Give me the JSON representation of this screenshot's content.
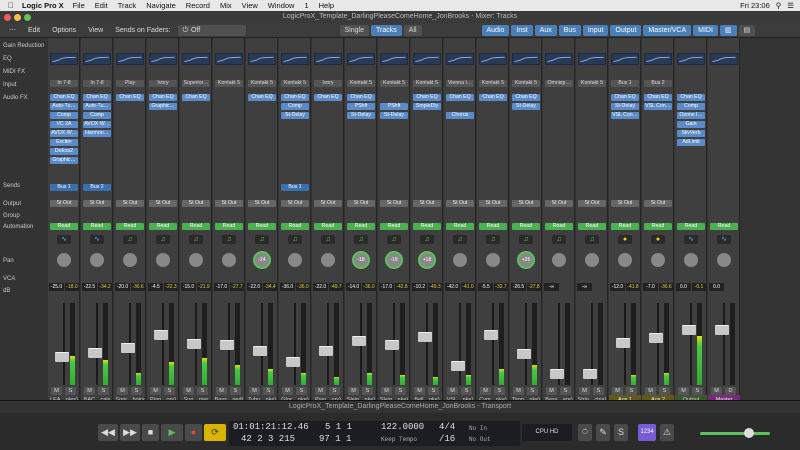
{
  "menubar": {
    "app": "Logic Pro X",
    "items": [
      "File",
      "Edit",
      "Track",
      "Navigate",
      "Record",
      "Mix",
      "View",
      "Window",
      "1",
      "Help"
    ],
    "clock": "Fri 23:06"
  },
  "window": {
    "title": "LogicProX_Template_DarlingPleaseComeHome_JonBrooks - Mixer: Tracks"
  },
  "toolbar": {
    "edit": "Edit",
    "options": "Options",
    "view": "View",
    "sends": "Sends on Faders:",
    "sends_value": "Off",
    "single": "Single",
    "tracks": "Tracks",
    "all": "All",
    "filters": [
      "Audio",
      "Inst",
      "Aux",
      "Bus",
      "Input",
      "Output",
      "Master/VCA",
      "MIDI"
    ]
  },
  "row_labels": [
    "Gain Reduction",
    "EQ",
    "MIDI FX",
    "Input",
    "Audio FX",
    "Sends",
    "Output",
    "Group",
    "Automation",
    "Pan",
    "VCA",
    "dB"
  ],
  "strips": [
    {
      "input": "In 7-8",
      "fx": [
        "Chan EQ",
        "Auto-Tu…",
        "Comp",
        "VC 2A",
        "AVOX W…",
        "Exciter",
        "DeEss2",
        "Graphic…"
      ],
      "send": "Bus 1",
      "output": "St Out",
      "auto": "Read",
      "pan": "",
      "vol": "-25.0",
      "peak": "-18.0",
      "name": "LEA…ples)",
      "fader": 68,
      "meter": 35,
      "icon": "wave"
    },
    {
      "input": "In 7-8",
      "fx": [
        "Chan EQ",
        "Auto-Tu…",
        "Comp",
        "AVOX W…",
        "Harmon…"
      ],
      "send": "Bus 2",
      "output": "St Out",
      "auto": "Read",
      "pan": "",
      "vol": "-22.5",
      "peak": "-34.2",
      "name": "BAC…cals",
      "fader": 62,
      "meter": 30,
      "icon": "wave"
    },
    {
      "input": "Play",
      "fx": [
        "Chan EQ"
      ],
      "send": "",
      "output": "St Out",
      "auto": "Read",
      "pan": "",
      "vol": "-20.0",
      "peak": "-36.6",
      "name": "Sopr…hoirs",
      "fader": 55,
      "meter": 15,
      "icon": "note"
    },
    {
      "input": "Ivory",
      "fx": [
        "Chan EQ",
        "Graphic…"
      ],
      "send": "",
      "output": "St Out",
      "auto": "Read",
      "pan": "",
      "vol": "-4.5",
      "peak": "-22.3",
      "name": "Pian…ory)",
      "fader": 38,
      "meter": 28,
      "icon": "note"
    },
    {
      "input": "Superior…",
      "fx": [
        "Chan EQ"
      ],
      "send": "",
      "output": "St Out",
      "auto": "Read",
      "pan": "",
      "vol": "-15.0",
      "peak": "-21.9",
      "name": "Sup…mer",
      "fader": 50,
      "meter": 33,
      "icon": "note"
    },
    {
      "input": "Kontakt 5",
      "fx": [],
      "send": "",
      "output": "St Out",
      "auto": "Read",
      "pan": "",
      "vol": "-17.0",
      "peak": "-27.7",
      "name": "Bass…ped)",
      "fader": 52,
      "meter": 25,
      "icon": "note"
    },
    {
      "input": "Kontakt 5",
      "fx": [
        "Chan EQ"
      ],
      "send": "",
      "output": "St Out",
      "auto": "Read",
      "pan": "-24",
      "vol": "-22.0",
      "peak": "-34.4",
      "name": "Tubu…nke)",
      "fader": 60,
      "meter": 20,
      "icon": "note"
    },
    {
      "input": "Kontakt 5",
      "fx": [
        "Chan EQ",
        "Comp",
        "St-Delay"
      ],
      "send": "Bus 1",
      "output": "St Out",
      "auto": "Read",
      "pan": "",
      "vol": "-36.0",
      "peak": "-36.0",
      "name": "Gloc…nke)",
      "fader": 75,
      "meter": 15,
      "icon": "note"
    },
    {
      "input": "Ivory",
      "fx": [
        "Chan EQ"
      ],
      "send": "",
      "output": "St Out",
      "auto": "Read",
      "pan": "",
      "vol": "-22.0",
      "peak": "-49.7",
      "name": "Pian…ory)",
      "fader": 60,
      "meter": 10,
      "icon": "note"
    },
    {
      "input": "Kontakt 5",
      "fx": [
        "Chan EQ",
        "PShft",
        "St-Delay"
      ],
      "send": "",
      "output": "St Out",
      "auto": "Read",
      "pan": "-18",
      "vol": "-14.0",
      "peak": "-36.0",
      "name": "Sleig…nke)",
      "fader": 46,
      "meter": 15,
      "icon": "note"
    },
    {
      "input": "Kontakt 5",
      "fx": [
        "",
        "PShft",
        "St-Delay"
      ],
      "send": "",
      "output": "St Out",
      "auto": "Read",
      "pan": "-18",
      "vol": "-17.0",
      "peak": "-42.8",
      "name": "Sleig…nke)",
      "fader": 52,
      "meter": 12,
      "icon": "note"
    },
    {
      "input": "Kontakt 5",
      "fx": [
        "Chan EQ",
        "SmpleDly"
      ],
      "send": "",
      "output": "St Out",
      "auto": "Read",
      "pan": "+18",
      "vol": "-10.2",
      "peak": "-49.3",
      "name": "Bell…nke)",
      "fader": 40,
      "meter": 10,
      "icon": "note"
    },
    {
      "input": "Vienna I…",
      "fx": [
        "Chan EQ",
        "",
        "Chorus"
      ],
      "send": "",
      "output": "St Out",
      "auto": "Read",
      "pan": "",
      "vol": "-42.0",
      "peak": "-41.0",
      "name": "VSL…nke)",
      "fader": 80,
      "meter": 12,
      "icon": "note"
    },
    {
      "input": "Kontakt 5",
      "fx": [
        "Chan EQ"
      ],
      "send": "",
      "output": "St Out",
      "auto": "Read",
      "pan": "",
      "vol": "-5.5",
      "peak": "-32.7",
      "name": "Cym…nke)",
      "fader": 38,
      "meter": 20,
      "icon": "note"
    },
    {
      "input": "Kontakt 5",
      "fx": [
        "Chan EQ",
        "St-Delay"
      ],
      "send": "",
      "output": "St Out",
      "auto": "Read",
      "pan": "+25",
      "vol": "-26.5",
      "peak": "-27.8",
      "name": "Timp…nke)",
      "fader": 64,
      "meter": 25,
      "icon": "note"
    },
    {
      "input": "Omnisp…",
      "fx": [],
      "send": "",
      "output": "St Out",
      "auto": "Read",
      "pan": "",
      "vol": "-∞",
      "peak": "",
      "name": "Bass…ere)",
      "fader": 92,
      "meter": 0,
      "icon": "note"
    },
    {
      "input": "Kontakt 5",
      "fx": [],
      "send": "",
      "output": "St Out",
      "auto": "Read",
      "pan": "",
      "vol": "-∞",
      "peak": "",
      "name": "Strin…cbia)",
      "fader": 92,
      "meter": 0,
      "icon": "note"
    },
    {
      "input": "Bus 1",
      "fx": [
        "Chan EQ",
        "St-Delay",
        "VSL Con…"
      ],
      "send": "",
      "output": "St Out",
      "auto": "Read",
      "pan": "",
      "vol": "-12.0",
      "peak": "-41.8",
      "name": "Aux 1",
      "fader": 48,
      "meter": 12,
      "icon": "yellow",
      "aux": true
    },
    {
      "input": "Bus 2",
      "fx": [
        "Chan EQ",
        "VSL Con…"
      ],
      "send": "",
      "output": "St Out",
      "auto": "Read",
      "pan": "",
      "vol": "-7.0",
      "peak": "-36.6",
      "name": "Aux 2",
      "fader": 42,
      "meter": 15,
      "icon": "yellow",
      "aux": true
    },
    {
      "input": "",
      "fx": [
        "Chan EQ",
        "Comp",
        "Ozone I…",
        "Gain",
        "SlivVerb",
        "AdLimit"
      ],
      "send": "",
      "output": "",
      "auto": "Read",
      "pan": "",
      "vol": "0.0",
      "peak": "-0.1",
      "name": "Output",
      "fader": 30,
      "meter": 60,
      "icon": "wave",
      "out": true
    },
    {
      "input": "",
      "fx": [],
      "send": "",
      "output": "",
      "auto": "Read",
      "pan": "",
      "vol": "0.0",
      "peak": "",
      "name": "Master",
      "fader": 30,
      "meter": 0,
      "icon": "wave",
      "master": true
    }
  ],
  "transport": {
    "title": "LogicProX_Template_DarlingPleaseComeHome_JonBrooks - Transport",
    "smpte": "01:01:21:12.46",
    "bars": "42  2  3  215",
    "pos1": "5  1  1",
    "pos2": "97  1  1",
    "tempo": "122.0000",
    "tempo_label": "Keep Tempo",
    "sig": "4/4",
    "key": "/16",
    "in": "No In",
    "out": "No Out",
    "cpu": "CPU",
    "hd": "HD",
    "badge": "1234"
  }
}
